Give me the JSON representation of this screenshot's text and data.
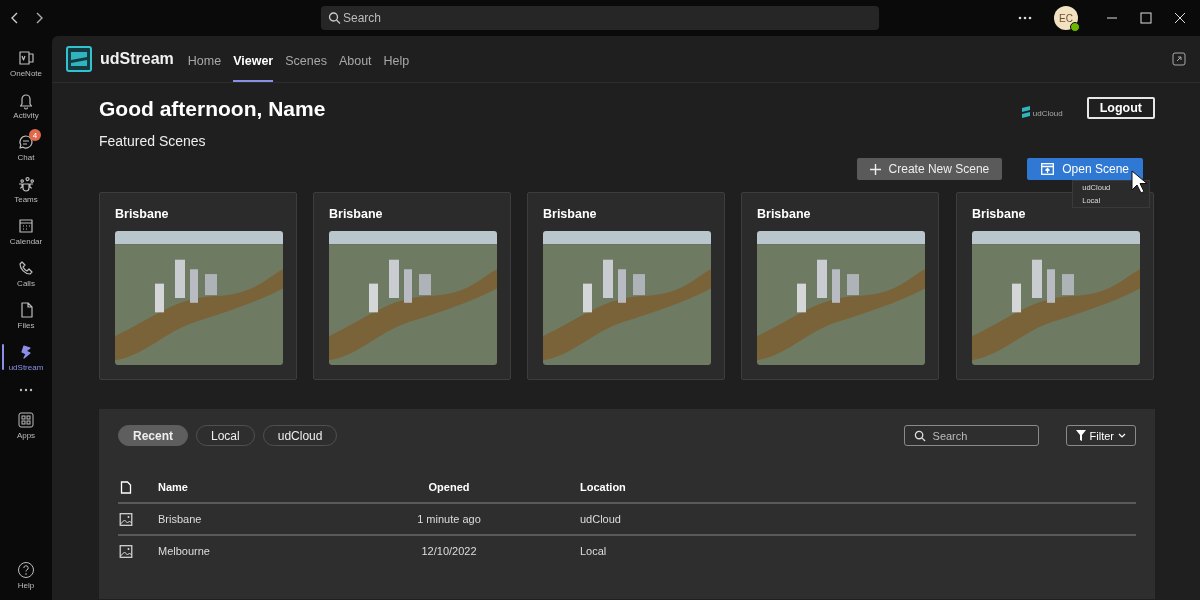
{
  "titlebar": {
    "search_placeholder": "Search",
    "avatar_initials": "EC"
  },
  "rail": {
    "items": [
      {
        "label": "OneNote",
        "selected": false
      },
      {
        "label": "Activity",
        "selected": false
      },
      {
        "label": "Chat",
        "selected": false,
        "badge": "4"
      },
      {
        "label": "Teams",
        "selected": false
      },
      {
        "label": "Calendar",
        "selected": false
      },
      {
        "label": "Calls",
        "selected": false
      },
      {
        "label": "Files",
        "selected": false
      },
      {
        "label": "udStream",
        "selected": true
      }
    ],
    "apps": {
      "label": "Apps"
    },
    "help": {
      "label": "Help"
    }
  },
  "app_header": {
    "brand": "udStream",
    "tabs": [
      {
        "label": "Home",
        "selected": false
      },
      {
        "label": "Viewer",
        "selected": true
      },
      {
        "label": "Scenes",
        "selected": false
      },
      {
        "label": "About",
        "selected": false
      },
      {
        "label": "Help",
        "selected": false
      }
    ]
  },
  "greeting": "Good afternoon, Name",
  "section_title": "Featured Scenes",
  "partner_logo": "udCloud",
  "logout": "Logout",
  "create_button": "Create New Scene",
  "open_button": {
    "label": "Open Scene",
    "expanded": true,
    "menu": [
      "udCloud",
      "Local"
    ]
  },
  "cards": [
    {
      "title": "Brisbane"
    },
    {
      "title": "Brisbane"
    },
    {
      "title": "Brisbane"
    },
    {
      "title": "Brisbane"
    },
    {
      "title": "Brisbane"
    }
  ],
  "recent": {
    "chips": [
      {
        "label": "Recent",
        "selected": true
      },
      {
        "label": "Local",
        "selected": false
      },
      {
        "label": "udCloud",
        "selected": false
      }
    ],
    "search_placeholder": "Search",
    "filter": "Filter",
    "columns": [
      "Name",
      "Opened",
      "Location"
    ],
    "rows": [
      {
        "name": "Brisbane",
        "opened": "1 minute ago",
        "location": "udCloud"
      },
      {
        "name": "Melbourne",
        "opened": "12/10/2022",
        "location": "Local"
      }
    ]
  }
}
